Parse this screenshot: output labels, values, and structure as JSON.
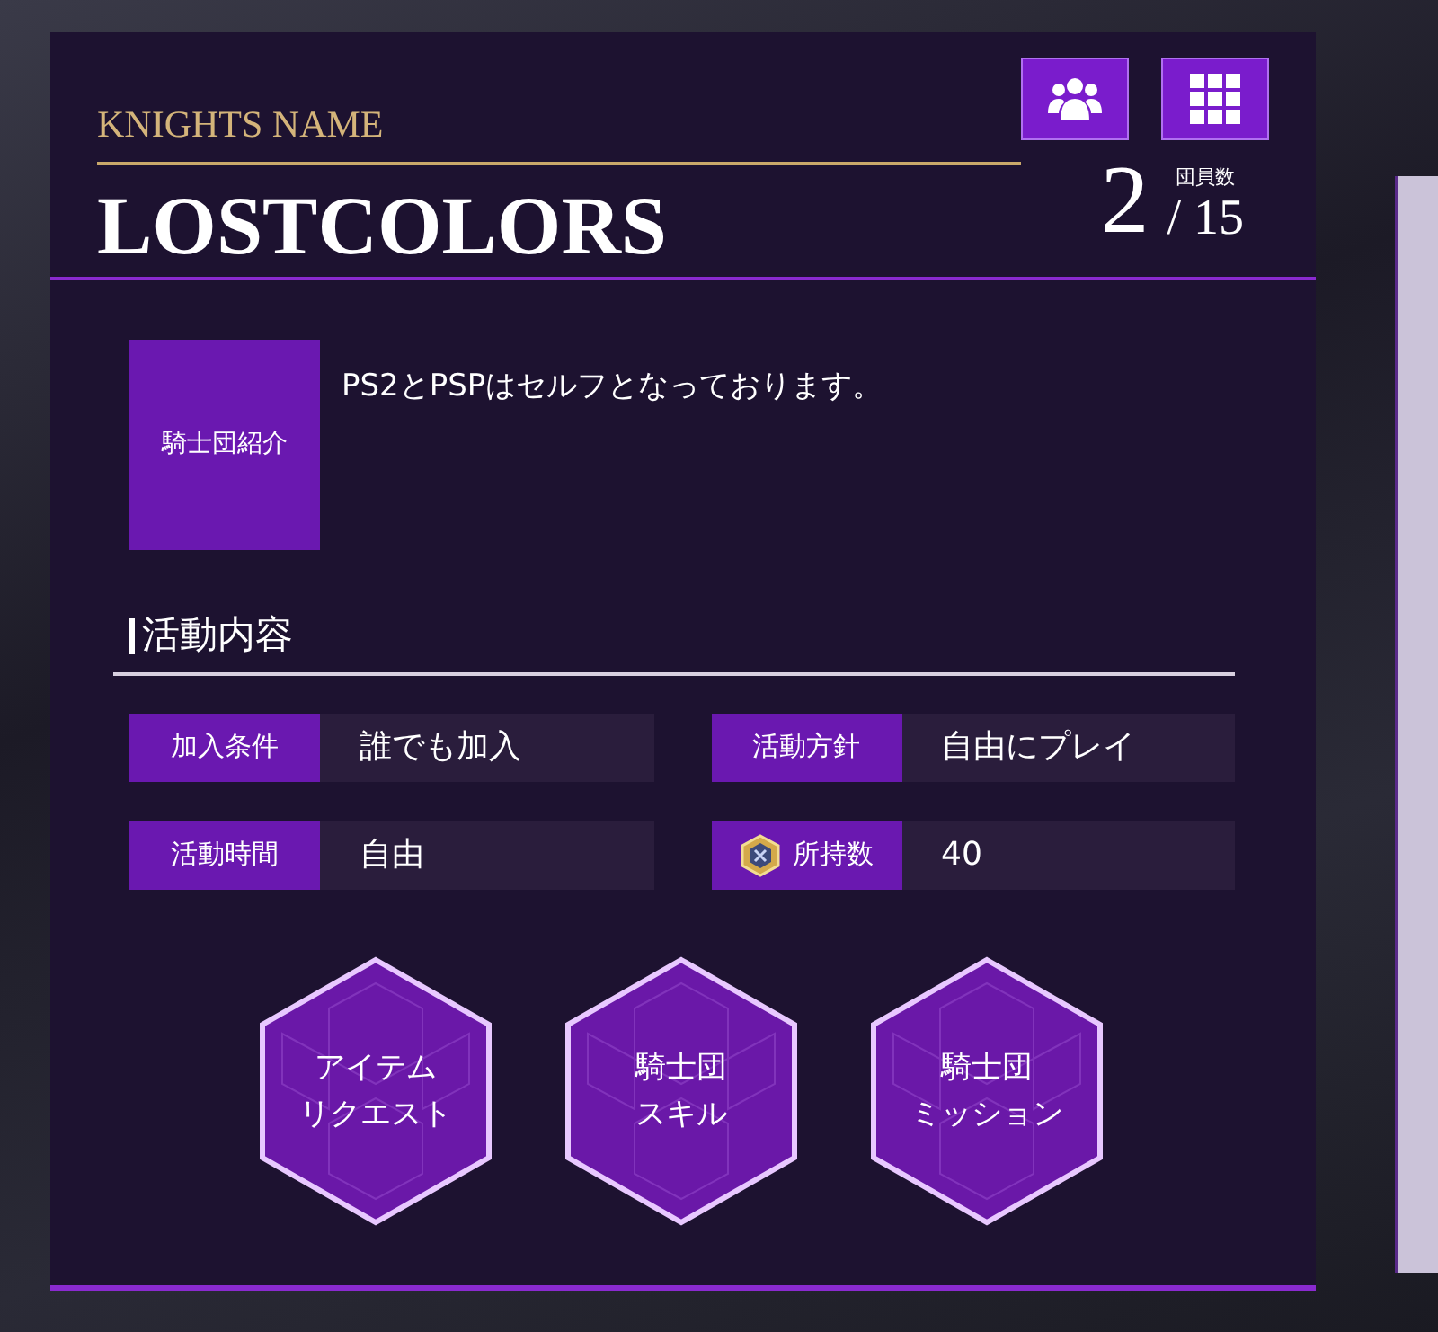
{
  "header": {
    "label": "KNIGHTS NAME",
    "name": "LOSTCOLORS",
    "member_count": "2",
    "member_label": "団員数",
    "member_max": "/ 15"
  },
  "intro": {
    "label": "騎士団紹介",
    "text": "PS2とPSPはセルフとなっております。"
  },
  "activity": {
    "title": "活動内容",
    "fields": [
      {
        "label": "加入条件",
        "value": "誰でも加入",
        "kind": "plain"
      },
      {
        "label": "活動方針",
        "value": "自由にプレイ",
        "kind": "plain"
      },
      {
        "label": "活動時間",
        "value": "自由",
        "kind": "plain"
      },
      {
        "label": "所持数",
        "value": "40",
        "kind": "currency"
      }
    ]
  },
  "actions": [
    {
      "lines": [
        "アイテム",
        "リクエスト"
      ]
    },
    {
      "lines": [
        "騎士団",
        "スキル"
      ]
    },
    {
      "lines": [
        "騎士団",
        "ミッション"
      ]
    }
  ]
}
